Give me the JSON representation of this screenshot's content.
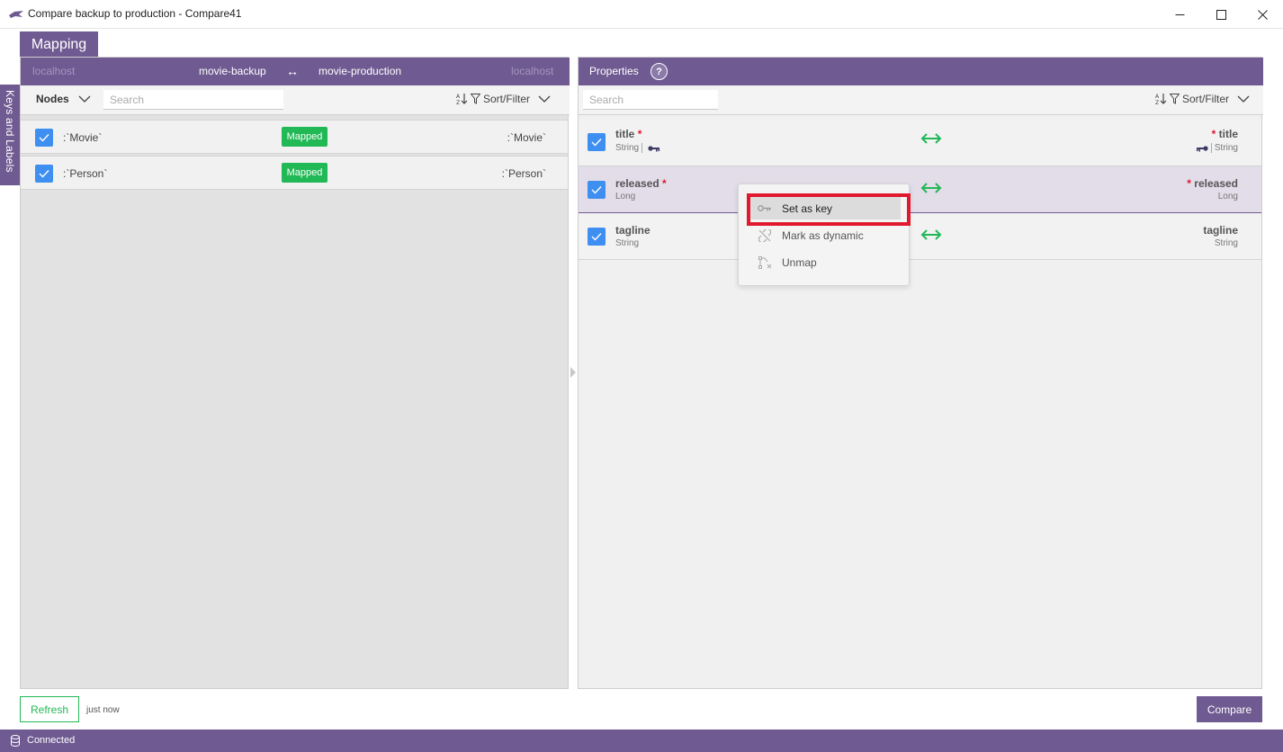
{
  "window": {
    "title": "Compare backup to production - Compare41"
  },
  "tabs": {
    "mapping": "Mapping",
    "side": "Keys and Labels"
  },
  "left": {
    "source_host": "localhost",
    "source_db": "movie-backup",
    "arrow": "↔",
    "target_db": "movie-production",
    "target_host": "localhost",
    "nodes_label": "Nodes",
    "search_placeholder": "Search",
    "sort_filter": "Sort/Filter",
    "rows": [
      {
        "left": ":`Movie`",
        "badge": "Mapped",
        "right": ":`Movie`",
        "checked": true
      },
      {
        "left": ":`Person`",
        "badge": "Mapped",
        "right": ":`Person`",
        "checked": true
      }
    ]
  },
  "right": {
    "title": "Properties",
    "help": "?",
    "search_placeholder": "Search",
    "sort_filter": "Sort/Filter",
    "rows": [
      {
        "name": "title",
        "required": "*",
        "type": "String",
        "name_r": "title",
        "type_r": "String",
        "is_key": true
      },
      {
        "name": "released",
        "required": "*",
        "type": "Long",
        "name_r": "released",
        "type_r": "Long",
        "is_key": false
      },
      {
        "name": "tagline",
        "required": "",
        "type": "String",
        "name_r": "tagline",
        "type_r": "String",
        "is_key": false
      }
    ]
  },
  "context_menu": {
    "items": [
      {
        "label": "Set as key",
        "icon": "key-icon"
      },
      {
        "label": "Mark as dynamic",
        "icon": "unlink-icon"
      },
      {
        "label": "Unmap",
        "icon": "unmap-icon"
      }
    ]
  },
  "footer": {
    "refresh": "Refresh",
    "refresh_time": "just now",
    "compare": "Compare"
  },
  "status": {
    "text": "Connected"
  },
  "colors": {
    "accent": "#6f5a91",
    "mapped": "#21b955",
    "checkbox": "#3e8ff0",
    "highlight": "#e0192e"
  }
}
